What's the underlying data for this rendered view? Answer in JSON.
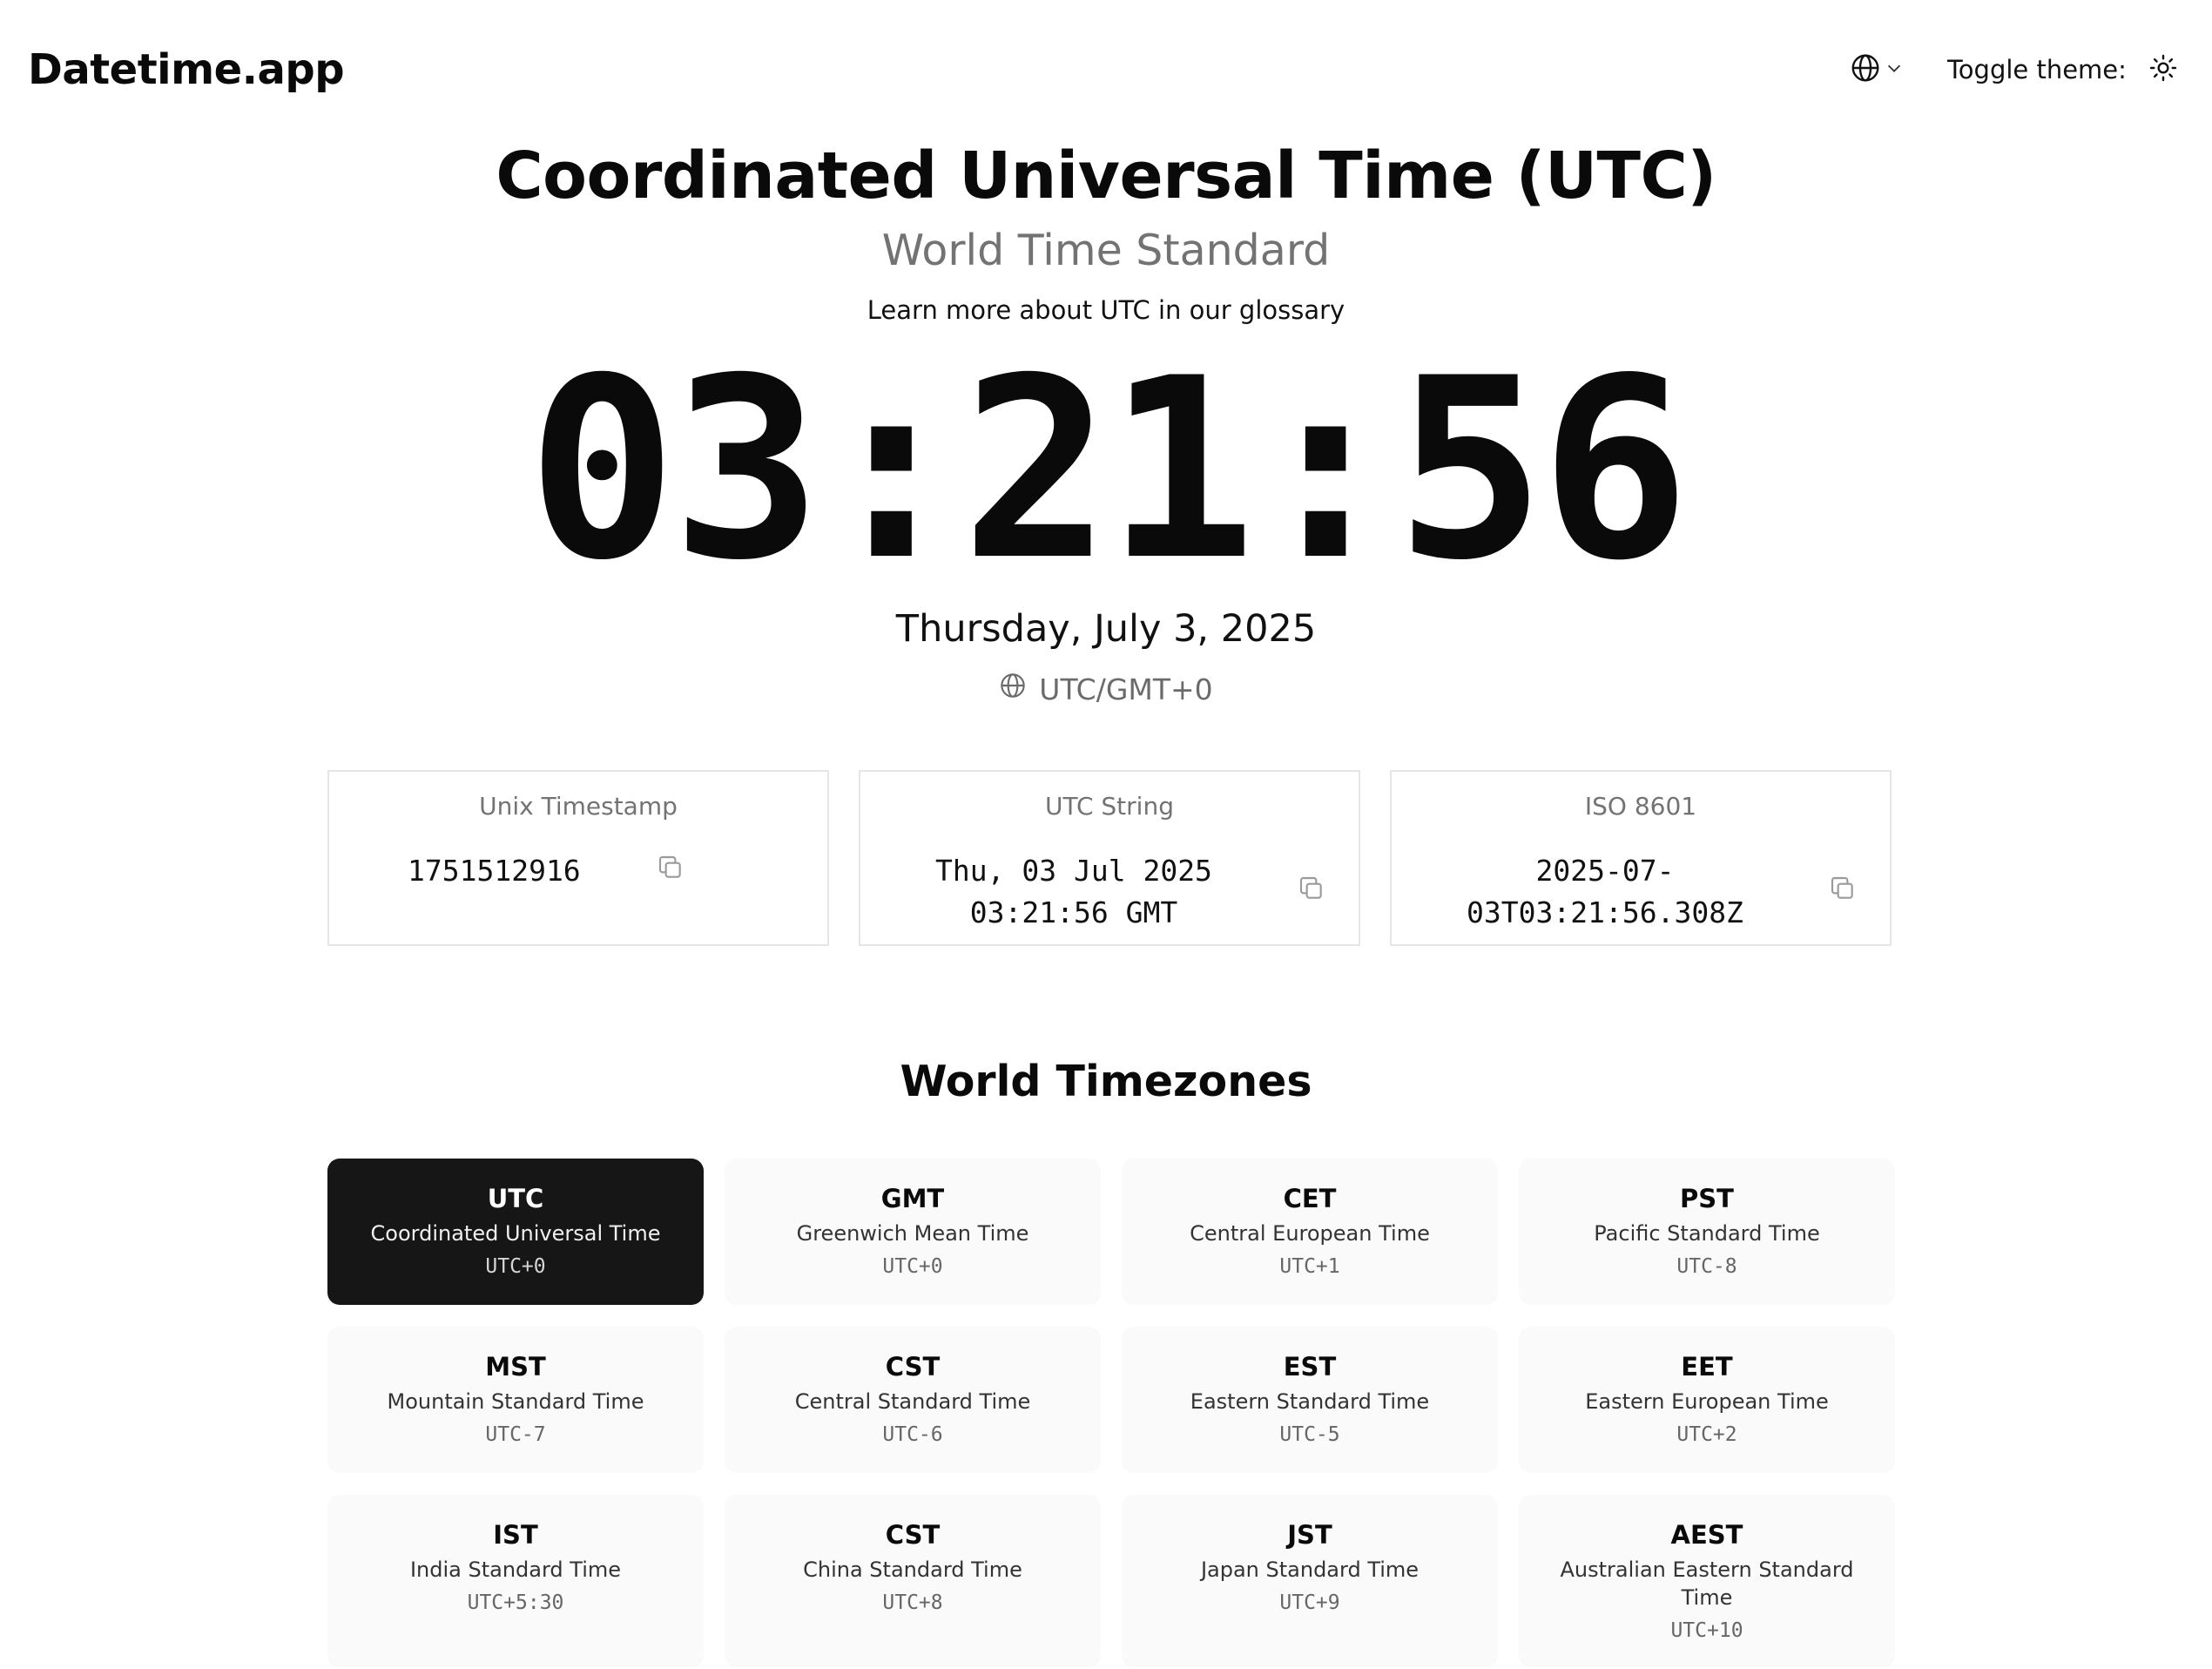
{
  "header": {
    "logo": "Datetime.app",
    "language_icon": "globe-icon",
    "theme_label": "Toggle theme:",
    "theme_icon": "sun-icon"
  },
  "hero": {
    "title": "Coordinated Universal Time (UTC)",
    "subtitle": "World Time Standard",
    "glossary_link": "Learn more about UTC in our glossary",
    "time": "03:21:56",
    "date": "Thursday, July 3, 2025",
    "zone": "UTC/GMT+0"
  },
  "cards": [
    {
      "label": "Unix Timestamp",
      "lines": [
        "1751512916"
      ]
    },
    {
      "label": "UTC String",
      "lines": [
        "Thu, 03 Jul 2025",
        "03:21:56 GMT"
      ]
    },
    {
      "label": "ISO 8601",
      "lines": [
        "2025-07-",
        "03T03:21:56.308Z"
      ]
    }
  ],
  "world": {
    "title": "World Timezones",
    "zones": [
      {
        "abbr": "UTC",
        "name": "Coordinated Universal Time",
        "offset": "UTC+0",
        "active": true
      },
      {
        "abbr": "GMT",
        "name": "Greenwich Mean Time",
        "offset": "UTC+0"
      },
      {
        "abbr": "CET",
        "name": "Central European Time",
        "offset": "UTC+1"
      },
      {
        "abbr": "PST",
        "name": "Pacific Standard Time",
        "offset": "UTC-8"
      },
      {
        "abbr": "MST",
        "name": "Mountain Standard Time",
        "offset": "UTC-7"
      },
      {
        "abbr": "CST",
        "name": "Central Standard Time",
        "offset": "UTC-6"
      },
      {
        "abbr": "EST",
        "name": "Eastern Standard Time",
        "offset": "UTC-5"
      },
      {
        "abbr": "EET",
        "name": "Eastern European Time",
        "offset": "UTC+2"
      },
      {
        "abbr": "IST",
        "name": "India Standard Time",
        "offset": "UTC+5:30"
      },
      {
        "abbr": "CST",
        "name": "China Standard Time",
        "offset": "UTC+8"
      },
      {
        "abbr": "JST",
        "name": "Japan Standard Time",
        "offset": "UTC+9"
      },
      {
        "abbr": "AEST",
        "name": "Australian Eastern Standard Time",
        "offset": "UTC+10"
      }
    ]
  }
}
